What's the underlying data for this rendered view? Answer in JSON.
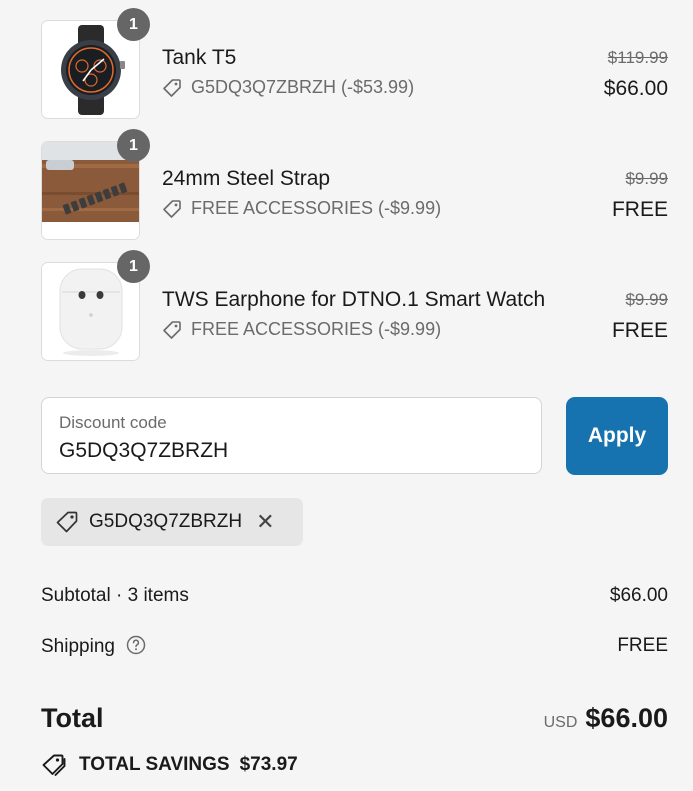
{
  "items": [
    {
      "quantity": "1",
      "name": "Tank T5",
      "discount": "G5DQ3Q7ZBRZH (-$53.99)",
      "original_price": "$119.99",
      "final_price": "$66.00",
      "image": "smartwatch-image"
    },
    {
      "quantity": "1",
      "name": "24mm Steel Strap",
      "discount": "FREE ACCESSORIES (-$9.99)",
      "original_price": "$9.99",
      "final_price": "FREE",
      "image": "steel-strap-image"
    },
    {
      "quantity": "1",
      "name": "TWS Earphone for DTNO.1 Smart Watch",
      "discount": "FREE ACCESSORIES (-$9.99)",
      "original_price": "$9.99",
      "final_price": "FREE",
      "image": "earphones-image"
    }
  ],
  "discount": {
    "label": "Discount code",
    "value": "G5DQ3Q7ZBRZH",
    "apply_label": "Apply",
    "applied_tag": "G5DQ3Q7ZBRZH"
  },
  "summary": {
    "subtotal_label": "Subtotal · 3 items",
    "subtotal_value": "$66.00",
    "shipping_label": "Shipping",
    "shipping_value": "FREE",
    "total_label": "Total",
    "currency": "USD",
    "total_value": "$66.00",
    "savings_label": "TOTAL SAVINGS",
    "savings_value": "$73.97"
  },
  "colors": {
    "accent": "#1773b0",
    "badge": "#666666",
    "background": "#f5f5f5"
  }
}
